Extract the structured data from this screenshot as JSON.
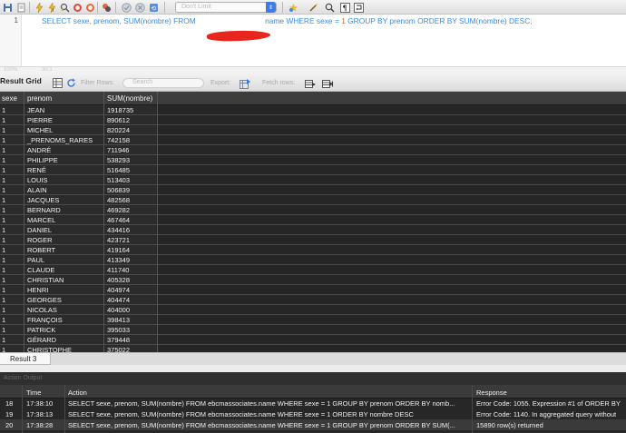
{
  "toolbar": {
    "limit_select": "Don't Limit",
    "icons": [
      "save-icon",
      "open-icon",
      "execute-icon",
      "execute-current-icon",
      "explain-icon",
      "stop-icon",
      "toggle-errors-icon",
      "commit-icon",
      "rollback-icon",
      "autocommit-icon",
      "beautify-icon",
      "find-icon",
      "invisible-chars-icon",
      "wrap-icon"
    ]
  },
  "editor": {
    "line_number": "1",
    "tokens": {
      "select": "SELECT",
      "cols": "sexe, prenom,",
      "sum1": "SUM",
      "sum1_arg": "(nombre)",
      "from": "FROM",
      "table": "name",
      "where": "WHERE",
      "cond": "sexe =",
      "val": "1",
      "groupby": "GROUP BY",
      "groupcol": "prenom",
      "orderby": "ORDER BY",
      "sum2": "SUM",
      "sum2_arg": "(nombre)",
      "desc": "DESC;"
    }
  },
  "status": {
    "zoom": "100%",
    "cursor": "30:1"
  },
  "grid_toolbar": {
    "tab": "Result Grid",
    "filter_label": "Filter Rows:",
    "filter_placeholder": "Search",
    "export_label": "Export:",
    "fetch_label": "Fetch rows:"
  },
  "grid": {
    "columns": [
      "sexe",
      "prenom",
      "SUM(nombre)"
    ],
    "rows": [
      [
        "1",
        "JEAN",
        "1918735"
      ],
      [
        "1",
        "PIERRE",
        "890612"
      ],
      [
        "1",
        "MICHEL",
        "820224"
      ],
      [
        "1",
        "_PRENOMS_RARES",
        "742158"
      ],
      [
        "1",
        "ANDRÉ",
        "711946"
      ],
      [
        "1",
        "PHILIPPE",
        "538293"
      ],
      [
        "1",
        "RENÉ",
        "516485"
      ],
      [
        "1",
        "LOUIS",
        "513403"
      ],
      [
        "1",
        "ALAIN",
        "506839"
      ],
      [
        "1",
        "JACQUES",
        "482568"
      ],
      [
        "1",
        "BERNARD",
        "469282"
      ],
      [
        "1",
        "MARCEL",
        "467464"
      ],
      [
        "1",
        "DANIEL",
        "434416"
      ],
      [
        "1",
        "ROGER",
        "423721"
      ],
      [
        "1",
        "ROBERT",
        "419164"
      ],
      [
        "1",
        "PAUL",
        "413349"
      ],
      [
        "1",
        "CLAUDE",
        "411740"
      ],
      [
        "1",
        "CHRISTIAN",
        "405328"
      ],
      [
        "1",
        "HENRI",
        "404974"
      ],
      [
        "1",
        "GEORGES",
        "404474"
      ],
      [
        "1",
        "NICOLAS",
        "404000"
      ],
      [
        "1",
        "FRANÇOIS",
        "398413"
      ],
      [
        "1",
        "PATRICK",
        "395033"
      ],
      [
        "1",
        "GÉRARD",
        "379448"
      ],
      [
        "1",
        "CHRISTOPHE",
        "375022"
      ]
    ]
  },
  "result_tab": "Result 3",
  "output": {
    "title": "Action Output",
    "columns": [
      "Time",
      "Action",
      "Response"
    ],
    "rows": [
      {
        "num": "18",
        "time": "17:38:10",
        "action": "SELECT sexe, prenom, SUM(nombre) FROM ebcmassociates.name WHERE sexe = 1 GROUP BY prenom ORDER BY nomb...",
        "response": "Error Code: 1055. Expression #1 of ORDER BY"
      },
      {
        "num": "19",
        "time": "17:38:13",
        "action": "SELECT sexe, prenom, SUM(nombre) FROM ebcmassociates.name WHERE sexe = 1 ORDER BY nombre DESC",
        "response": "Error Code: 1140. In aggregated query without"
      },
      {
        "num": "20",
        "time": "17:38:28",
        "action": "SELECT sexe, prenom, SUM(nombre) FROM ebcmassociates.name WHERE sexe = 1 GROUP BY prenom ORDER BY SUM(...",
        "response": "15890 row(s) returned"
      }
    ]
  }
}
